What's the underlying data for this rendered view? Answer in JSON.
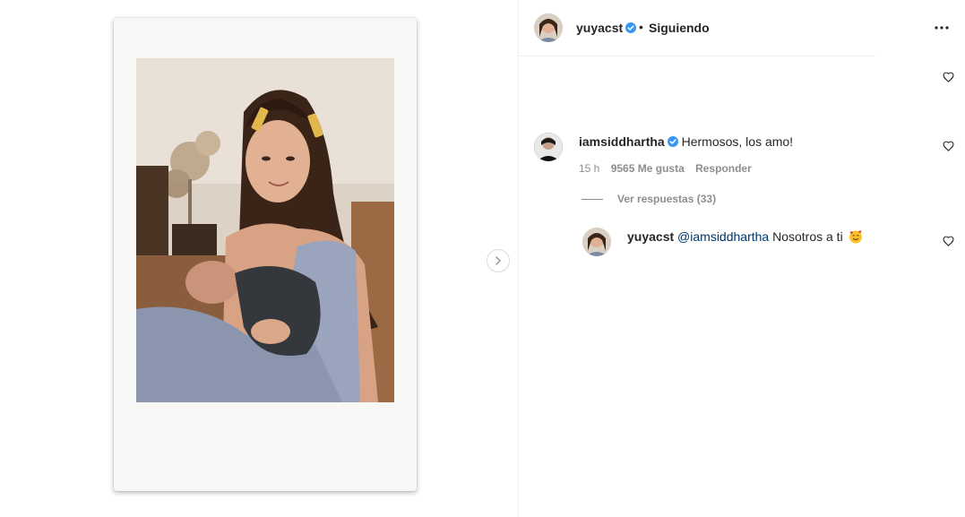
{
  "post": {
    "author": "yuyacst",
    "separator": "•",
    "follow_status": "Siguiendo",
    "more_icon": "more-horizontal-icon"
  },
  "comments": [
    {
      "user": "iamsiddhartha",
      "verified": true,
      "text": "Hermosos, los amo!",
      "time": "15 h",
      "likes": "9565 Me gusta",
      "reply_label": "Responder",
      "view_replies": "Ver respuestas (33)"
    }
  ],
  "reply": {
    "user": "yuyacst",
    "mention": "@iamsiddhartha",
    "text": " Nosotros a ti",
    "emoji": "smiling-face-with-hearts-emoji"
  },
  "colors": {
    "verified_blue": "#3897f0",
    "mention_blue": "#00376b",
    "muted_gray": "#8e8e8e",
    "text": "#262626"
  }
}
